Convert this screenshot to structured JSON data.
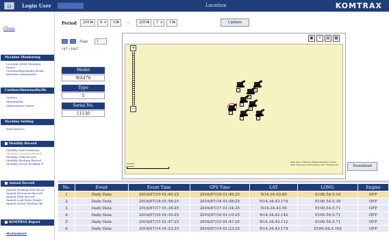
{
  "header": {
    "login_label": "Login User",
    "title": "Location",
    "logo": "KOMTRAX",
    "home_icon": "home-icon"
  },
  "sidebar": {
    "close_label": "Close",
    "sections": [
      {
        "title": "Machine Monitoring",
        "items": [
          "Location (SMR (Working",
          "Status",
          "Caution/Abnormality/Resm",
          "Attention Information"
        ]
      },
      {
        "title": "Caution/Abnormality/Re",
        "items": [
          "Caution",
          "Abnormality",
          "Maintenance Status"
        ]
      },
      {
        "title": "Machine Setting",
        "items": [
          "Data Restore"
        ]
      },
      {
        "title": "Monthly Record",
        "items": [
          "Monthly Data Summary",
          "Monthly Location Record",
          "Monthly SMR Record",
          "Monthly Working Record",
          "Monthly Actual Working Ti"
        ]
      },
      {
        "title": "Annual Record",
        "items": [
          "Annual Working Rest Recor",
          "Annual Movement Record",
          "Annual SMR Record",
          "Annual Load Ratio Graph",
          "Annual Actual Working Ra"
        ]
      },
      {
        "title": "KOMTRAX Report",
        "items": []
      }
    ],
    "bottom_link": "Worksheet"
  },
  "period": {
    "label": "Period",
    "from_year": "2016",
    "from_month": "6",
    "from_day": "19",
    "separator": "-",
    "to_year": "2016",
    "to_month": "7",
    "to_day": "19",
    "update_label": "Update"
  },
  "paging": {
    "page_label": "Page",
    "page_value": "1",
    "range": "147～1067"
  },
  "machine_info": {
    "model_label": "Model",
    "model_value": "WA470",
    "type_label": "Type",
    "type_value": "5",
    "serial_label": "Serial No.",
    "serial_value": "11136"
  },
  "map": {
    "copyright": "Map data: ©Zenrin, Rights Reserved, Some data ©Europa Technologies, and ©Navteq Inc.",
    "download_label": "Download",
    "markers": [
      "2",
      "3",
      "4",
      "5",
      "6",
      "1",
      "7",
      "8"
    ]
  },
  "table": {
    "columns": [
      "No.",
      "Event",
      "Event Time",
      "GPS Time",
      "LAT.",
      "LONG.",
      "Engine"
    ],
    "rows": [
      [
        "1",
        "Daily Data",
        "2016/07/19 01:46:25",
        "2016/07/19 01:46:25",
        "N14.34.43.80",
        "E100.54.5.10",
        "OFF"
      ],
      [
        "2",
        "Daily Data",
        "2016/07/18 01:58:25",
        "2016/07/18 01:58:25",
        "N14.34.43.174",
        "E100.54.5.39",
        "OFF"
      ],
      [
        "3",
        "Daily Data",
        "2016/07/17 01:34:25",
        "2016/07/17 01:34:25",
        "N14.34.43.50",
        "E100.54.5.71",
        "OFF"
      ],
      [
        "4",
        "Daily Data",
        "2016/07/16 01:10:25",
        "2016/07/16 01:10:25",
        "N14.34.43.142",
        "E100.54.5.71",
        "OFF"
      ],
      [
        "5",
        "Daily Data",
        "2016/07/15 01:47:25",
        "2016/07/15 01:47:25",
        "N14.34.43.112",
        "E100.54.5.71",
        "OFF"
      ],
      [
        "6",
        "Daily Data",
        "2016/07/14 01:23:25",
        "2016/07/14 01:23:25",
        "N14.34.43.174",
        "E100.54.5.102",
        "OFF"
      ]
    ]
  }
}
